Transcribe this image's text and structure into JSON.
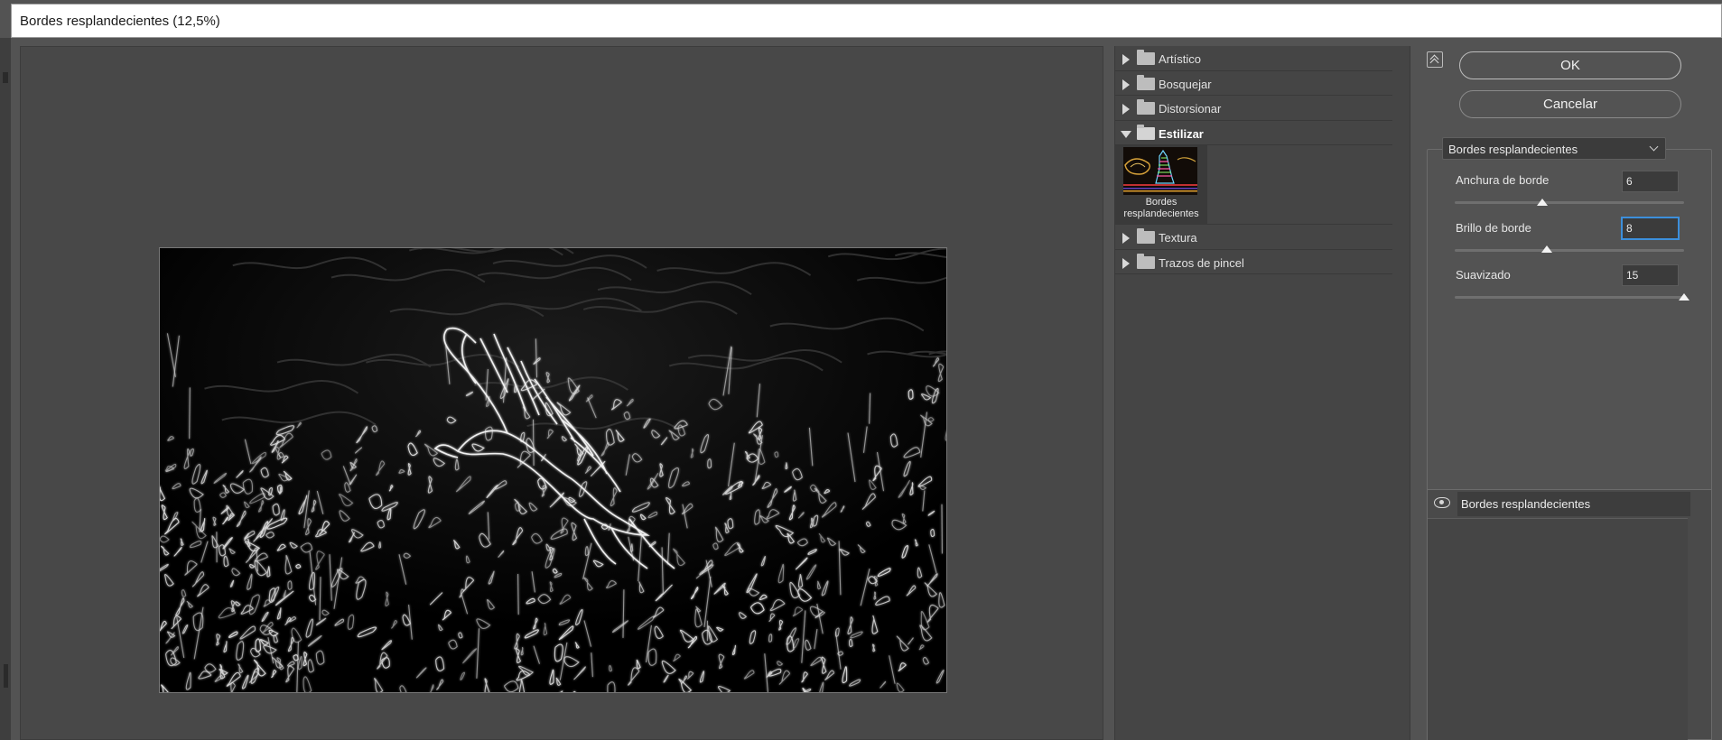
{
  "window": {
    "title": "Bordes resplandecientes (12,5%)"
  },
  "filter_gallery": {
    "folders": [
      {
        "label": "Artístico",
        "open": false
      },
      {
        "label": "Bosquejar",
        "open": false
      },
      {
        "label": "Distorsionar",
        "open": false
      },
      {
        "label": "Estilizar",
        "open": true
      },
      {
        "label": "Textura",
        "open": false
      },
      {
        "label": "Trazos de pincel",
        "open": false
      }
    ],
    "selected_filter": {
      "label": "Bordes resplandecientes"
    }
  },
  "actions": {
    "ok_label": "OK",
    "cancel_label": "Cancelar"
  },
  "settings": {
    "filter_select": "Bordes resplandecientes",
    "params": [
      {
        "label": "Anchura de borde",
        "value": "6",
        "min": 1,
        "max": 14,
        "fraction": 0.38
      },
      {
        "label": "Brillo de borde",
        "value": "8",
        "min": 0,
        "max": 20,
        "fraction": 0.4
      },
      {
        "label": "Suavizado",
        "value": "15",
        "min": 1,
        "max": 15,
        "fraction": 1.0
      }
    ]
  },
  "effect_layers": [
    {
      "label": "Bordes resplandecientes",
      "visible": true
    }
  ],
  "colors": {
    "accent_focus": "#3c8fdb",
    "panel_bg": "#535353"
  },
  "icons": [
    "collapse-icon",
    "folder-icon",
    "disclosure-triangle-icon",
    "eye-icon",
    "chevron-down-icon"
  ]
}
